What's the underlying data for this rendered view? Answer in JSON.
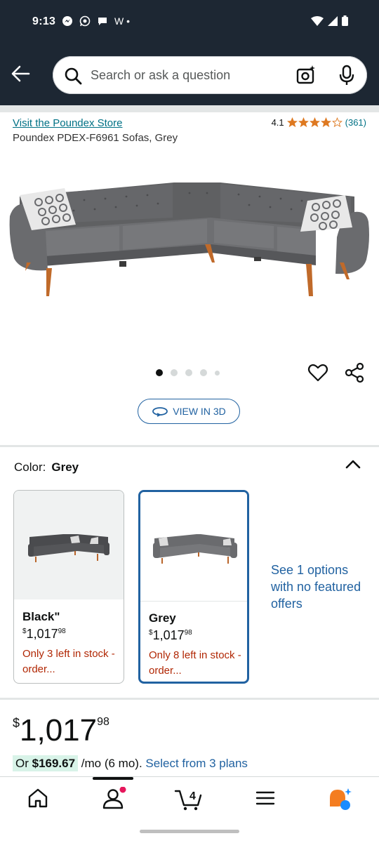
{
  "status_bar": {
    "time": "9:13",
    "extra": "W •"
  },
  "search": {
    "placeholder": "Search or ask a question"
  },
  "product": {
    "store_link": "Visit the Poundex Store",
    "title": "Poundex PDEX-F6961 Sofas, Grey",
    "rating": "4.1",
    "rating_count": "(361)",
    "stars_filled": 4.1
  },
  "view3d": {
    "label": "VIEW IN 3D"
  },
  "color": {
    "label": "Color:",
    "selected": "Grey"
  },
  "swatches": [
    {
      "name": "Black\"",
      "currency": "$",
      "price": "1,017",
      "cents": "98",
      "stock": "Only 3 left in stock - order..."
    },
    {
      "name": "Grey",
      "currency": "$",
      "price": "1,017",
      "cents": "98",
      "stock": "Only 8 left in stock - order..."
    }
  ],
  "see_options": "See 1 options with no featured offers",
  "price": {
    "currency": "$",
    "whole": "1,017",
    "cents": "98"
  },
  "installment": {
    "prefix": "Or ",
    "amount": "$169.67",
    "suffix": " /mo (6 mo). ",
    "plans": "Select from 3 plans"
  },
  "cart_count": "4",
  "colors": {
    "header_bg": "#1d2733",
    "link": "#2162a1",
    "stock_red": "#b12704",
    "star": "#de7921"
  }
}
